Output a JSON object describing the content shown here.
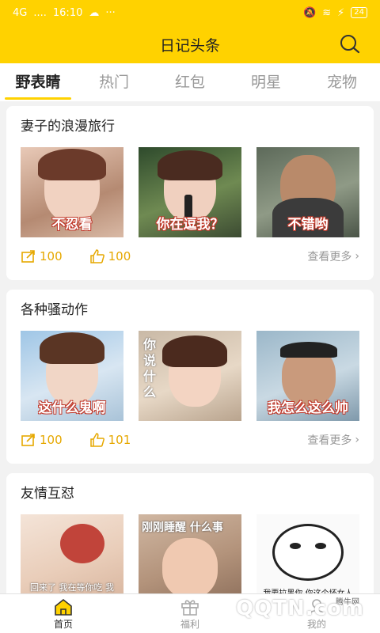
{
  "status_bar": {
    "signal": "4G",
    "dots_left": "....",
    "time": "16:10",
    "dots_right": "···",
    "battery": "24"
  },
  "header": {
    "title": "日记头条"
  },
  "tabs": [
    {
      "label": "野表睛"
    },
    {
      "label": "热门"
    },
    {
      "label": "红包"
    },
    {
      "label": "明星"
    },
    {
      "label": "宠物"
    }
  ],
  "cards": [
    {
      "title": "妻子的浪漫旅行",
      "captions": [
        "不忍看",
        "你在逗我？",
        "不错哟"
      ],
      "shares": "100",
      "likes": "100",
      "more": "查看更多"
    },
    {
      "title": "各种骚动作",
      "captions": [
        "这什么鬼啊",
        "你说什么",
        "我怎么这么帅"
      ],
      "shares": "100",
      "likes": "101",
      "more": "查看更多"
    },
    {
      "title": "友情互怼",
      "captions": [
        "回来了 我在等你吃 我",
        "刚刚睡醒 什么事",
        "我要拉黑你,你这个坏女人"
      ],
      "shares": "",
      "likes": "",
      "more": ""
    }
  ],
  "bottom_nav": [
    {
      "label": "首页"
    },
    {
      "label": "福利"
    },
    {
      "label": "我的"
    }
  ],
  "watermark": {
    "text": "QQTN.com",
    "sub": "腾牛网"
  },
  "colors": {
    "brand": "#ffd200",
    "accent_text": "#e6a800"
  }
}
